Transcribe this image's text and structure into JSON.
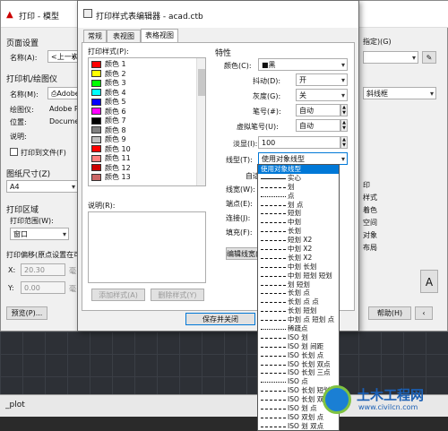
{
  "bg": {
    "title": "打印 - 模型",
    "page_setup_label": "页面设置",
    "name_label": "名称(A):",
    "name_value": "<上一次",
    "printer_label": "打印机/绘图仪",
    "printer_name_label": "名称(M):",
    "printer_name_value": "Adobe",
    "plotter_label": "绘图仪:",
    "plotter_value": "Adobe PD",
    "location_label": "位置:",
    "location_value": "Document",
    "desc_label": "说明:",
    "print_to_file_label": "打印到文件(F)",
    "paper_size_label": "图纸尺寸(Z)",
    "paper_size_value": "A4",
    "plot_area_label": "打印区域",
    "plot_range_label": "打印范围(W):",
    "plot_range_value": "窗口",
    "plot_offset_label": "打印偏移(原点设置在可",
    "x_label": "X:",
    "x_value": "20.30",
    "y_label": "Y:",
    "y_value": "0.00",
    "preview_button": "预览(P)...",
    "right_specify": "指定)(G)",
    "right_linewidth": "斜线框",
    "right_items": [
      "印",
      "样式",
      "着色",
      "空间",
      "对象",
      "布局"
    ],
    "help_button": "帮助(H)",
    "cmd_text": "_plot"
  },
  "editor": {
    "title": "打印样式表编辑器 - acad.ctb",
    "tabs": [
      "常规",
      "表视图",
      "表格视图"
    ],
    "print_styles_label": "打印样式(P):",
    "styles": [
      {
        "name": "颜色 1",
        "color": "#ff0000"
      },
      {
        "name": "颜色 2",
        "color": "#ffff00"
      },
      {
        "name": "颜色 3",
        "color": "#00ff00"
      },
      {
        "name": "颜色 4",
        "color": "#00ffff"
      },
      {
        "name": "颜色 5",
        "color": "#0000ff"
      },
      {
        "name": "颜色 6",
        "color": "#ff00ff"
      },
      {
        "name": "颜色 7",
        "color": "#000000"
      },
      {
        "name": "颜色 8",
        "color": "#808080"
      },
      {
        "name": "颜色 9",
        "color": "#c0c0c0"
      },
      {
        "name": "颜色 10",
        "color": "#ff0000"
      },
      {
        "name": "颜色 11",
        "color": "#ff7f7f"
      },
      {
        "name": "颜色 12",
        "color": "#cc0000"
      },
      {
        "name": "颜色 13",
        "color": "#cc6666"
      }
    ],
    "desc_label": "说明(R):",
    "add_style_button": "添加样式(A)",
    "delete_style_button": "删除样式(Y)",
    "save_close_button": "保存并关闭",
    "props_label": "特性",
    "color_label": "颜色(C):",
    "color_value": "■黑",
    "dither_label": "抖动(D):",
    "dither_value": "开",
    "gray_label": "灰度(G):",
    "gray_value": "关",
    "pen_label": "笔号(#):",
    "pen_value": "自动",
    "vpen_label": "虚拟笔号(U):",
    "vpen_value": "自动",
    "screening_label": "淡显(I):",
    "screening_value": "100",
    "linetype_label": "线型(T):",
    "linetype_value": "使用对象线型",
    "adaptive_label": "自适",
    "lineweight_label": "线宽(W):",
    "endstyle_label": "端点(E):",
    "joinstyle_label": "连接(J):",
    "fill_label": "填充(F):",
    "edit_lineweight_button": "编辑线宽(L)",
    "linetypes": [
      "使用对象线型",
      "实心",
      "划",
      "点",
      "划 点",
      "短划",
      "中划",
      "长划",
      "短划 X2",
      "中划 X2",
      "长划 X2",
      "中划 长划",
      "中划 短划 短划",
      "划 短划",
      "长划 点",
      "长划 点 点",
      "长划 短划",
      "中划 点 短划 点",
      "稀疏点",
      "ISO 划",
      "ISO 划 间距",
      "ISO 长划 点",
      "ISO 长划 双点",
      "ISO 长划 三点",
      "ISO 点",
      "ISO 长划 短划",
      "ISO 长划 双短划",
      "ISO 划 点",
      "ISO 双划 点",
      "ISO 划 双点"
    ]
  },
  "watermark": {
    "brand": "土木工程网",
    "url": "www.civilcn.com"
  }
}
